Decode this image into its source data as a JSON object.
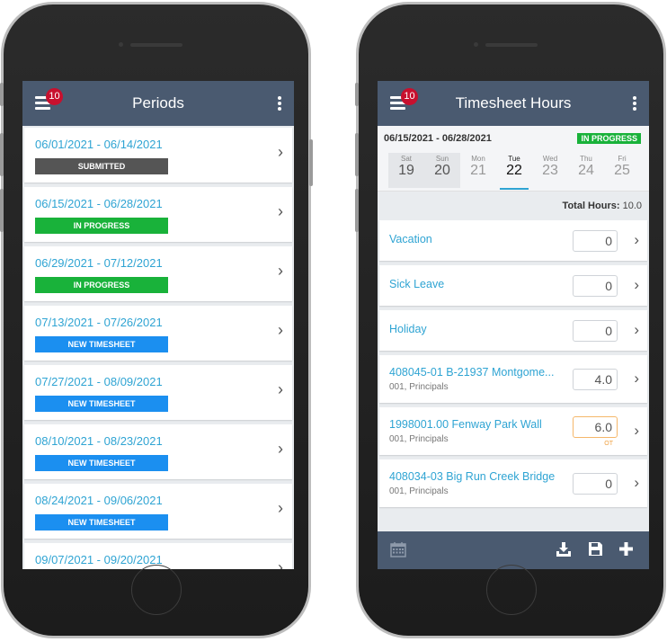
{
  "left_phone": {
    "notification_count": "10",
    "title": "Periods",
    "periods": [
      {
        "range": "06/01/2021 - 06/14/2021",
        "status": "SUBMITTED",
        "status_color": "#555555"
      },
      {
        "range": "06/15/2021 - 06/28/2021",
        "status": "IN PROGRESS",
        "status_color": "#19b23a"
      },
      {
        "range": "06/29/2021 - 07/12/2021",
        "status": "IN PROGRESS",
        "status_color": "#19b23a"
      },
      {
        "range": "07/13/2021 - 07/26/2021",
        "status": "NEW TIMESHEET",
        "status_color": "#1b8ff0"
      },
      {
        "range": "07/27/2021 - 08/09/2021",
        "status": "NEW TIMESHEET",
        "status_color": "#1b8ff0"
      },
      {
        "range": "08/10/2021 - 08/23/2021",
        "status": "NEW TIMESHEET",
        "status_color": "#1b8ff0"
      },
      {
        "range": "08/24/2021 - 09/06/2021",
        "status": "NEW TIMESHEET",
        "status_color": "#1b8ff0"
      },
      {
        "range": "09/07/2021 - 09/20/2021",
        "status": "",
        "status_color": ""
      }
    ]
  },
  "right_phone": {
    "notification_count": "10",
    "title": "Timesheet Hours",
    "range": "06/15/2021 - 06/28/2021",
    "status": "IN PROGRESS",
    "days": [
      {
        "name": "Sat",
        "date": "19",
        "weekend": true,
        "selected": false
      },
      {
        "name": "Sun",
        "date": "20",
        "weekend": true,
        "selected": false
      },
      {
        "name": "Mon",
        "date": "21",
        "weekend": false,
        "selected": false
      },
      {
        "name": "Tue",
        "date": "22",
        "weekend": false,
        "selected": true
      },
      {
        "name": "Wed",
        "date": "23",
        "weekend": false,
        "selected": false
      },
      {
        "name": "Thu",
        "date": "24",
        "weekend": false,
        "selected": false
      },
      {
        "name": "Fri",
        "date": "25",
        "weekend": false,
        "selected": false
      }
    ],
    "total_label": "Total Hours:",
    "total_value": "10.0",
    "entries": [
      {
        "name": "Vacation",
        "sub": "",
        "hours": "0",
        "ot": ""
      },
      {
        "name": "Sick Leave",
        "sub": "",
        "hours": "0",
        "ot": ""
      },
      {
        "name": "Holiday",
        "sub": "",
        "hours": "0",
        "ot": ""
      },
      {
        "name": "408045-01 B-21937 Montgome...",
        "sub": "001, Principals",
        "hours": "4.0",
        "ot": ""
      },
      {
        "name": "1998001.00 Fenway Park Wall",
        "sub": "001, Principals",
        "hours": "6.0",
        "ot": "OT"
      },
      {
        "name": "408034-03 Big Run Creek Bridge",
        "sub": "001, Principals",
        "hours": "0",
        "ot": ""
      }
    ],
    "bottom_icons": [
      "calendar-icon",
      "download-icon",
      "save-icon",
      "plus-icon"
    ]
  }
}
